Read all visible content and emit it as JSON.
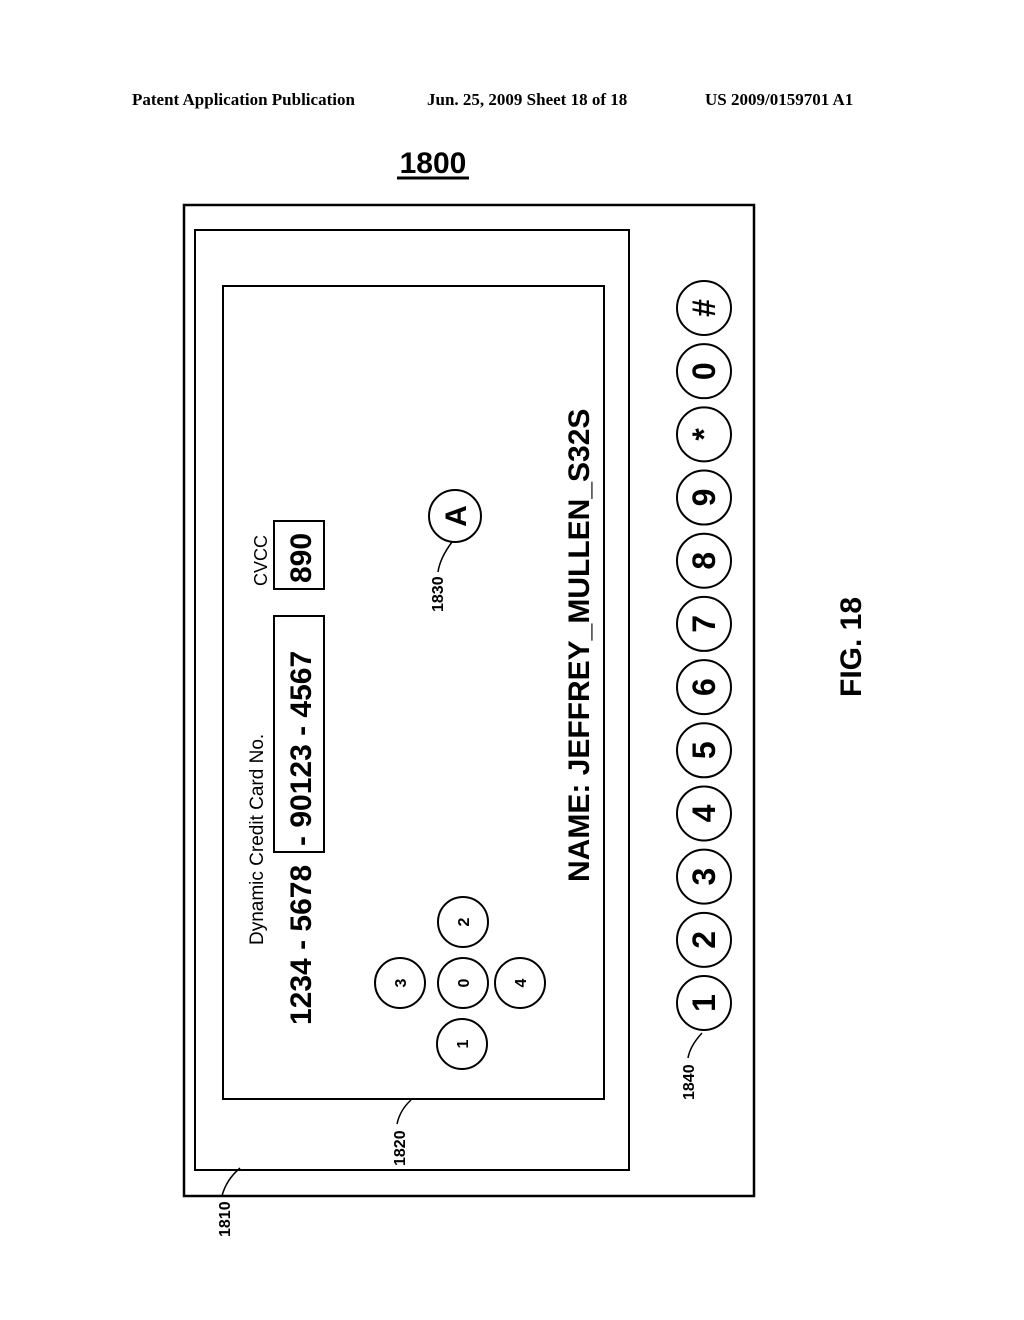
{
  "header": {
    "publication": "Patent Application Publication",
    "date_sheet": "Jun. 25, 2009  Sheet 18 of 18",
    "patent_number": "US 2009/0159701 A1"
  },
  "figure": {
    "number": "1800",
    "caption": "FIG. 18",
    "ref_outer": "1810",
    "ref_screen": "1820",
    "ref_nav": "1830",
    "ref_keypad": "1840"
  },
  "card": {
    "title": "Dynamic Credit Card No.",
    "static_part": "1234 - 5678",
    "dynamic_part": "- 90123 - 4567",
    "cvcc_label": "CVCC",
    "cvcc_value": "890",
    "name": "NAME: JEFFREY_MULLEN_S32S"
  },
  "nav_button": {
    "label": "A"
  },
  "dpad": {
    "up": "2",
    "left": "3",
    "center": "0",
    "right": "4",
    "down": "1"
  },
  "keypad": [
    "1",
    "2",
    "3",
    "4",
    "5",
    "6",
    "7",
    "8",
    "9",
    "*",
    "0",
    "#"
  ]
}
